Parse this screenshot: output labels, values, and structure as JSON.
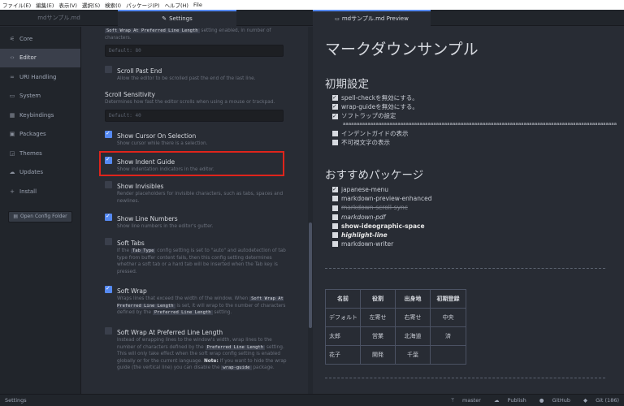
{
  "menubar": {
    "items": [
      "ファイル(E)",
      "編集(E)",
      "表示(V)",
      "選択(S)",
      "検索(I)",
      "パッケージ(P)",
      "ヘルプ(H)",
      "File"
    ]
  },
  "tabs": {
    "md": "mdサンプル.md",
    "settings": "Settings",
    "preview": "mdサンプル.md Preview"
  },
  "settings_menu": {
    "items": [
      {
        "icon": "sliders-icon",
        "label": "Core"
      },
      {
        "icon": "code-icon",
        "label": "Editor"
      },
      {
        "icon": "link-icon",
        "label": "URI Handling"
      },
      {
        "icon": "monitor-icon",
        "label": "System"
      },
      {
        "icon": "keyboard-icon",
        "label": "Keybindings"
      },
      {
        "icon": "package-icon",
        "label": "Packages"
      },
      {
        "icon": "paintcan-icon",
        "label": "Themes"
      },
      {
        "icon": "cloud-download-icon",
        "label": "Updates"
      },
      {
        "icon": "plus-icon",
        "label": "Install"
      }
    ],
    "open_config": "Open Config Folder"
  },
  "settings": {
    "top_desc_pre": "",
    "top_desc_code": "Soft Wrap At Preferred Line Length",
    "top_desc_post": " setting enabled, in number of characters.",
    "default_80": "Default: 80",
    "scroll_past_end_title": "Scroll Past End",
    "scroll_past_end_desc": "Allow the editor to be scrolled past the end of the last line.",
    "scroll_sensitivity_title": "Scroll Sensitivity",
    "scroll_sensitivity_desc": "Determines how fast the editor scrolls when using a mouse or trackpad.",
    "default_40": "Default: 40",
    "cursor_title": "Show Cursor On Selection",
    "cursor_desc": "Show cursor while there is a selection.",
    "indent_title": "Show Indent Guide",
    "indent_desc": "Show indentation indicators in the editor.",
    "invisibles_title": "Show Invisibles",
    "invisibles_desc": "Render placeholders for invisible characters, such as tabs, spaces and newlines.",
    "line_numbers_title": "Show Line Numbers",
    "line_numbers_desc": "Show line numbers in the editor's gutter.",
    "soft_tabs_title": "Soft Tabs",
    "soft_tabs_desc_1": "If the ",
    "soft_tabs_code": "Tab Type",
    "soft_tabs_desc_2": " config setting is set to \"auto\" and autodetection of tab type from buffer content fails, then this config setting determines whether a soft tab or a hard tab will be inserted when the Tab key is pressed.",
    "soft_wrap_title": "Soft Wrap",
    "soft_wrap_desc_1": "Wraps lines that exceed the width of the window. When ",
    "soft_wrap_code_1": "Soft Wrap At Preferred Line Length",
    "soft_wrap_desc_2": " is set, it will wrap to the number of characters defined by the ",
    "soft_wrap_code_2": "Preferred Line Length",
    "soft_wrap_desc_3": " setting.",
    "swap_title": "Soft Wrap At Preferred Line Length",
    "swap_desc_1": "Instead of wrapping lines to the window's width, wrap lines to the number of characters defined by the ",
    "swap_code_1": "Preferred Line Length",
    "swap_desc_2": " setting. This will only take effect when the soft wrap config setting is enabled globally or for the current language. ",
    "swap_note": "Note:",
    "swap_desc_3": " If you want to hide the wrap guide (the vertical line) you can disable the ",
    "swap_code_2": "wrap-guide",
    "swap_desc_4": " package."
  },
  "preview": {
    "h1": "マークダウンサンプル",
    "h2_1": "初期設定",
    "list1": [
      {
        "checked": true,
        "text": "spell-checkを無効にする。"
      },
      {
        "checked": true,
        "text": "wrap-guideを無効にする。"
      },
      {
        "checked": true,
        "text": "ソフトラップの設定"
      }
    ],
    "long_a": "aaaaaaaaaaaaaaaaaaaaaaaaaaaaaaaaaaaaaaaaaaaaaaaaaaaaaaaaaaaaaaaaaaaaaaaaaaaaaaaaaaaaaaaaaaaaaaaaaaaa",
    "list1b": [
      {
        "checked": false,
        "text": "インデントガイドの表示"
      },
      {
        "checked": false,
        "text": "不可視文字の表示"
      }
    ],
    "h2_2": "おすすめパッケージ",
    "list2": [
      {
        "checked": true,
        "text": "japanese-menu",
        "style": "normal"
      },
      {
        "checked": false,
        "text": "markdown-preview-enhanced",
        "style": "normal"
      },
      {
        "checked": false,
        "text": "markdown-scroll-sync",
        "style": "strike"
      },
      {
        "checked": false,
        "text": "markdown-pdf",
        "style": "italic"
      },
      {
        "checked": false,
        "text": "show-ideographic-space",
        "style": "bold"
      },
      {
        "checked": false,
        "text": "highlight-line",
        "style": "bolditalic"
      },
      {
        "checked": false,
        "text": "markdown-writer",
        "style": "normal"
      }
    ],
    "table": {
      "headers": [
        "名前",
        "役割",
        "出身地",
        "初期登録"
      ],
      "rows": [
        [
          "デフォルト",
          "左寄せ",
          "右寄せ",
          "中央"
        ],
        [
          "太郎",
          "営業",
          "北海道",
          "済"
        ],
        [
          "花子",
          "開発",
          "千葉",
          ""
        ]
      ]
    }
  },
  "statusbar": {
    "left": "Settings",
    "branch": "master",
    "publish": "Publish",
    "github": "GitHub",
    "git": "Git (186)"
  }
}
